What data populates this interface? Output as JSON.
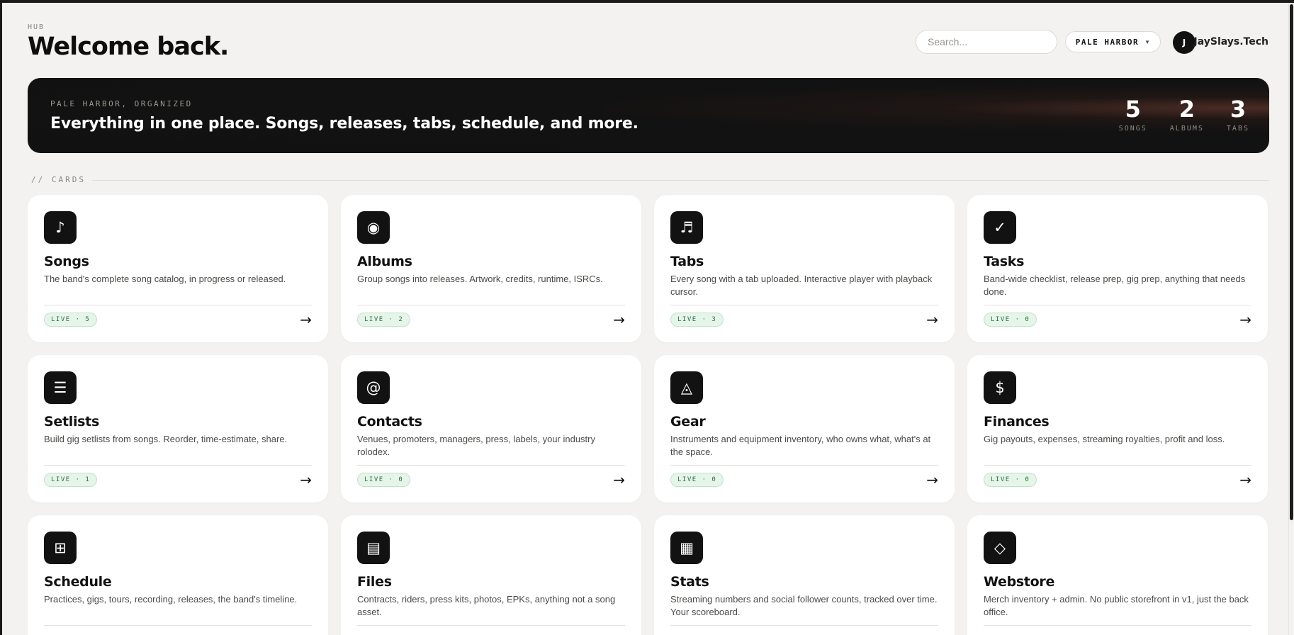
{
  "header": {
    "eyebrow": "HUB",
    "title": "Welcome back.",
    "search_placeholder": "Search...",
    "band_select": "PALE HARBOR",
    "avatar_initial": "J",
    "username": "JaySlays.Tech"
  },
  "hero": {
    "eyebrow": "PALE HARBOR, ORGANIZED",
    "title": "Everything in one place. Songs, releases, tabs, schedule, and more.",
    "stats": [
      {
        "value": "5",
        "label": "SONGS"
      },
      {
        "value": "2",
        "label": "ALBUMS"
      },
      {
        "value": "3",
        "label": "TABS"
      }
    ]
  },
  "section": {
    "label": "// CARDS"
  },
  "cards": [
    {
      "icon": "♪",
      "icon_name": "music-note-icon",
      "title": "Songs",
      "desc": "The band's complete song catalog, in progress or released.",
      "badge": "LIVE · 5",
      "arrow": "→"
    },
    {
      "icon": "◉",
      "icon_name": "disc-icon",
      "title": "Albums",
      "desc": "Group songs into releases. Artwork, credits, runtime, ISRCs.",
      "badge": "LIVE · 2",
      "arrow": "→"
    },
    {
      "icon": "♬",
      "icon_name": "sheet-music-icon",
      "title": "Tabs",
      "desc": "Every song with a tab uploaded. Interactive player with playback cursor.",
      "badge": "LIVE · 3",
      "arrow": "→"
    },
    {
      "icon": "✓",
      "icon_name": "checkmark-icon",
      "title": "Tasks",
      "desc": "Band-wide checklist, release prep, gig prep, anything that needs done.",
      "badge": "LIVE · 0",
      "arrow": "→"
    },
    {
      "icon": "☰",
      "icon_name": "list-icon",
      "title": "Setlists",
      "desc": "Build gig setlists from songs. Reorder, time-estimate, share.",
      "badge": "LIVE · 1",
      "arrow": "→"
    },
    {
      "icon": "@",
      "icon_name": "at-sign-icon",
      "title": "Contacts",
      "desc": "Venues, promoters, managers, press, labels, your industry rolodex.",
      "badge": "LIVE · 0",
      "arrow": "→"
    },
    {
      "icon": "◬",
      "icon_name": "triangle-icon",
      "title": "Gear",
      "desc": "Instruments and equipment inventory, who owns what, what's at the space.",
      "badge": "LIVE · 0",
      "arrow": "→"
    },
    {
      "icon": "$",
      "icon_name": "dollar-icon",
      "title": "Finances",
      "desc": "Gig payouts, expenses, streaming royalties, profit and loss.",
      "badge": "LIVE · 0",
      "arrow": "→"
    },
    {
      "icon": "⊞",
      "icon_name": "calendar-grid-icon",
      "title": "Schedule",
      "desc": "Practices, gigs, tours, recording, releases, the band's timeline.",
      "badge": "",
      "arrow": "→"
    },
    {
      "icon": "▤",
      "icon_name": "document-icon",
      "title": "Files",
      "desc": "Contracts, riders, press kits, photos, EPKs, anything not a song asset.",
      "badge": "",
      "arrow": "→"
    },
    {
      "icon": "▦",
      "icon_name": "stats-grid-icon",
      "title": "Stats",
      "desc": "Streaming numbers and social follower counts, tracked over time. Your scoreboard.",
      "badge": "",
      "arrow": "→"
    },
    {
      "icon": "◇",
      "icon_name": "diamond-icon",
      "title": "Webstore",
      "desc": "Merch inventory + admin. No public storefront in v1, just the back office.",
      "badge": "",
      "arrow": "→"
    }
  ]
}
